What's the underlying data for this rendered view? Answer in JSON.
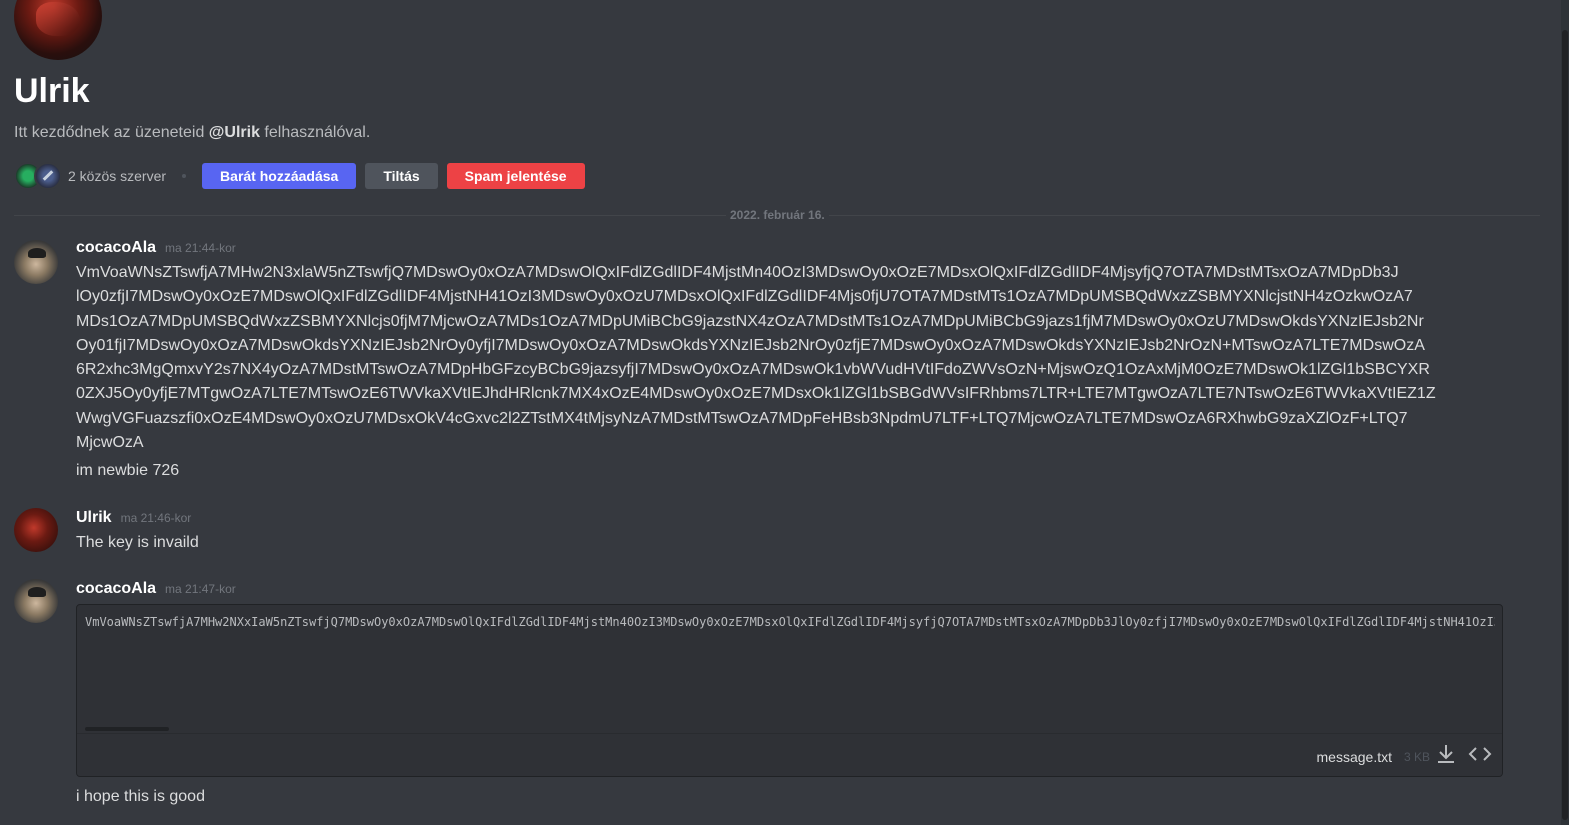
{
  "profile": {
    "name": "Ulrik",
    "intro_before": "Itt kezdődnek az üzeneteid ",
    "intro_mention": "@Ulrik",
    "intro_after": " felhasználóval.",
    "mutual_servers": "2 közös szerver",
    "add_friend_label": "Barát hozzáadása",
    "block_label": "Tiltás",
    "report_label": "Spam jelentése"
  },
  "divider": {
    "date": "2022. február 16."
  },
  "messages": [
    {
      "author": "cocacoAla",
      "timestamp": "ma 21:44-kor",
      "lines": [
        "VmVoaWNsZTswfjA7MHw2N3xlaW5nZTswfjQ7MDswOy0xOzA7MDswOlQxIFdlZGdlIDF4MjstMn40OzI3MDswOy0xOzE7MDsxOlQxIFdlZGdlIDF4MjsyfjQ7OTA7MDstMTsxOzA7MDpDb3J",
        "lOy0zfjI7MDswOy0xOzE7MDswOlQxIFdlZGdlIDF4MjstNH41OzI3MDswOy0xOzU7MDsxOlQxIFdlZGdlIDF4Mjs0fjU7OTA7MDstMTs1OzA7MDpUMSBQdWxzZSBMYXNlcjstNH4zOzkwOzA7",
        "MDs1OzA7MDpUMSBQdWxzZSBMYXNlcjs0fjM7MjcwOzA7MDs1OzA7MDpUMiBCbG9jazstNX4zOzA7MDstMTs1OzA7MDpUMiBCbG9jazs1fjM7MDswOy0xOzU7MDswOkdsYXNzIEJsb2Nr",
        "Oy01fjI7MDswOy0xOzA7MDswOkdsYXNzIEJsb2NrOy0yfjI7MDswOy0xOzA7MDswOkdsYXNzIEJsb2NrOy0zfjE7MDswOy0xOzA7MDswOkdsYXNzIEJsb2NrOzN+MTswOzA7LTE7MDswOzA",
        "6R2xhc3MgQmxvY2s7NX4yOzA7MDstMTswOzA7MDpHbGFzcyBCbG9jazsyfjI7MDswOy0xOzA7MDswOk1vbWVudHVtIFdoZWVsOzN+MjswOzQ1OzAxMjM0OzE7MDswOk1lZGl1bSBCYXR",
        "0ZXJ5Oy0yfjE7MTgwOzA7LTE7MTswOzE6TWVkaXVtIEJhdHRlcnk7MX4xOzE4MDswOy0xOzE7MDsxOk1lZGl1bSBGdWVsIFRhbms7LTR+LTE7MTgwOzA7LTE7NTswOzE6TWVkaXVtIEZ1Z",
        "WwgVGFuazszfi0xOzE4MDswOy0xOzU7MDsxOkV4cGxvc2l2ZTstMX4tMjsyNzA7MDstMTswOzA7MDpFeHBsb3NpdmU7LTF+LTQ7MjcwOzA7LTE7MDswOzA6RXhwbG9zaXZlOzF+LTQ7",
        "MjcwOzA"
      ],
      "followup": "im newbie 726"
    },
    {
      "author": "Ulrik",
      "timestamp": "ma 21:46-kor",
      "text": "The key is invaild"
    },
    {
      "author": "cocacoAla",
      "timestamp": "ma 21:47-kor",
      "attachment": {
        "preview": "VmVoaWNsZTswfjA7MHw2NXxIaW5nZTswfjQ7MDswOy0xOzA7MDswOlQxIFdlZGdlIDF4MjstMn40OzI3MDswOy0xOzE7MDsxOlQxIFdlZGdlIDF4MjsyfjQ7OTA7MDstMTsxOzA7MDpDb3JlOy0zfjI7MDswOy0xOzE7MDswOlQxIFdlZGdlIDF4MjstNH41OzI3MDswOy0xOzU7MDsxOlQxIFdlZGdlIDF4",
        "filename": "message.txt",
        "size": "3 KB"
      },
      "followup": "i hope this is good"
    }
  ]
}
